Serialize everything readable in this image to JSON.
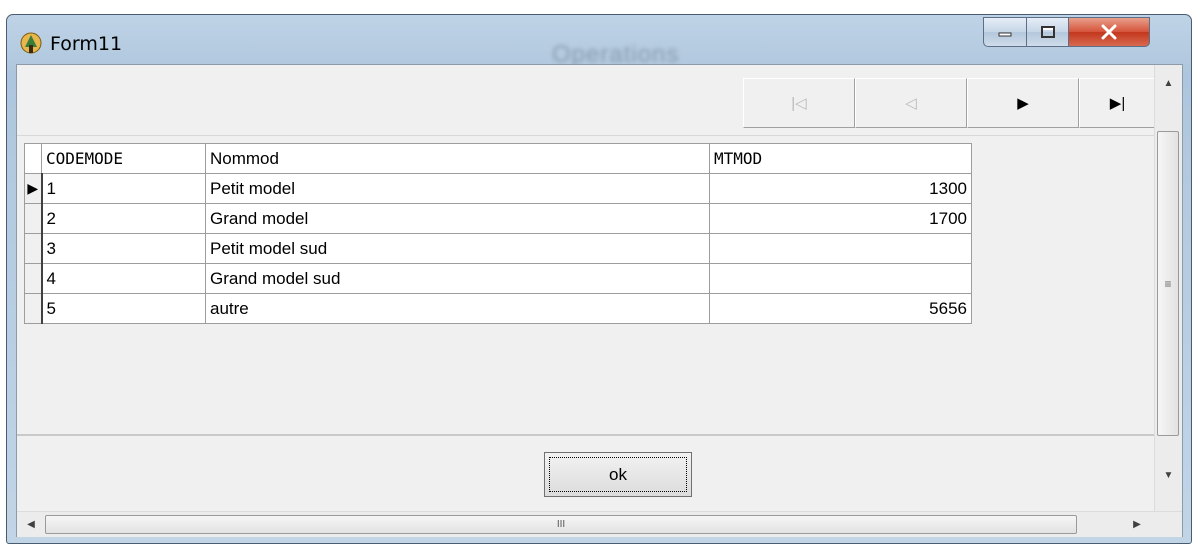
{
  "window": {
    "title": "Form11",
    "background_title": "Operations"
  },
  "caption_buttons": {
    "minimize": "—",
    "maximize": "□",
    "close": "X"
  },
  "navigator": {
    "buttons": [
      {
        "name": "first",
        "glyph": "|◁",
        "enabled": false
      },
      {
        "name": "prior",
        "glyph": "◁",
        "enabled": false
      },
      {
        "name": "next",
        "glyph": "▶",
        "enabled": true
      },
      {
        "name": "last",
        "glyph": "▶|",
        "enabled": true
      }
    ]
  },
  "grid": {
    "columns": [
      "CODEMODE",
      "Nommod",
      "MTMOD"
    ],
    "current_row_indicator": "▶",
    "rows": [
      {
        "codemode": "1",
        "nommod": "Petit model",
        "mtmod": "1300",
        "current": true
      },
      {
        "codemode": "2",
        "nommod": "Grand model",
        "mtmod": "1700",
        "current": false
      },
      {
        "codemode": "3",
        "nommod": "Petit model sud",
        "mtmod": "",
        "current": false
      },
      {
        "codemode": "4",
        "nommod": "Grand model sud",
        "mtmod": "",
        "current": false
      },
      {
        "codemode": "5",
        "nommod": "autre",
        "mtmod": "5656",
        "current": false
      }
    ]
  },
  "footer": {
    "ok_label": "ok"
  },
  "scrollbars": {
    "vertical_grip": "≡",
    "horizontal_grip": "III"
  },
  "colors": {
    "close_button": "#c8391d",
    "title_bar": "#b5cbe0",
    "client_bg": "#f0f0f0"
  }
}
